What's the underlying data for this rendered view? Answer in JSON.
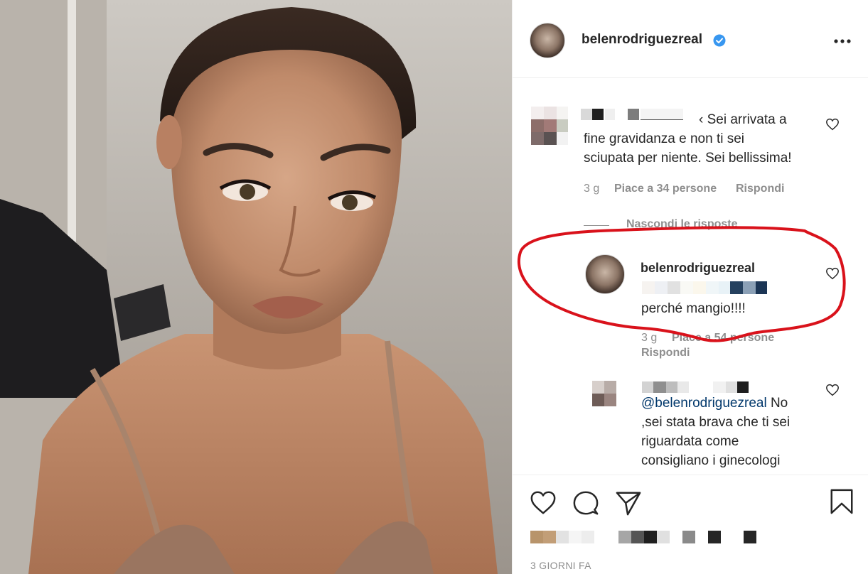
{
  "post": {
    "author": "belenrodriguezreal",
    "verified": true,
    "time_ago": "3 GIORNI FA"
  },
  "comments": [
    {
      "text_prefix": "‹ Sei arrivata a",
      "text_rest": "fine gravidanza e non ti sei sciupata per niente. Sei bellissima!",
      "line2": "fine gravidanza e non ti sei",
      "line3": "sciupata per niente. Sei bellissima!",
      "time": "3 g",
      "likes": "Piace a 34 persone",
      "reply": "Rispondi"
    }
  ],
  "replies_toggle": "Nascondi le risposte",
  "reply_highlighted": {
    "username": "belenrodriguezreal",
    "text": "perché mangio!!!!",
    "time": "3 g",
    "likes": "Piace a 54 persone",
    "reply": "Rispondi"
  },
  "reply_second": {
    "mention": "@belenrodriguezreal",
    "line1_rest": " No",
    "line2": ",sei stata brava che ti sei",
    "line3": "riguardata come",
    "line4": "consigliano i ginecologi"
  },
  "icons": {
    "like": "heart-icon",
    "comment": "comment-icon",
    "share": "paper-plane-icon",
    "save": "bookmark-icon",
    "more": "more-options-icon",
    "verified": "verified-badge-icon"
  },
  "colors": {
    "verified_blue": "#3897f0",
    "annotation_red": "#d9121b",
    "mention_blue": "#00376b",
    "secondary_text": "#8e8e8e"
  }
}
